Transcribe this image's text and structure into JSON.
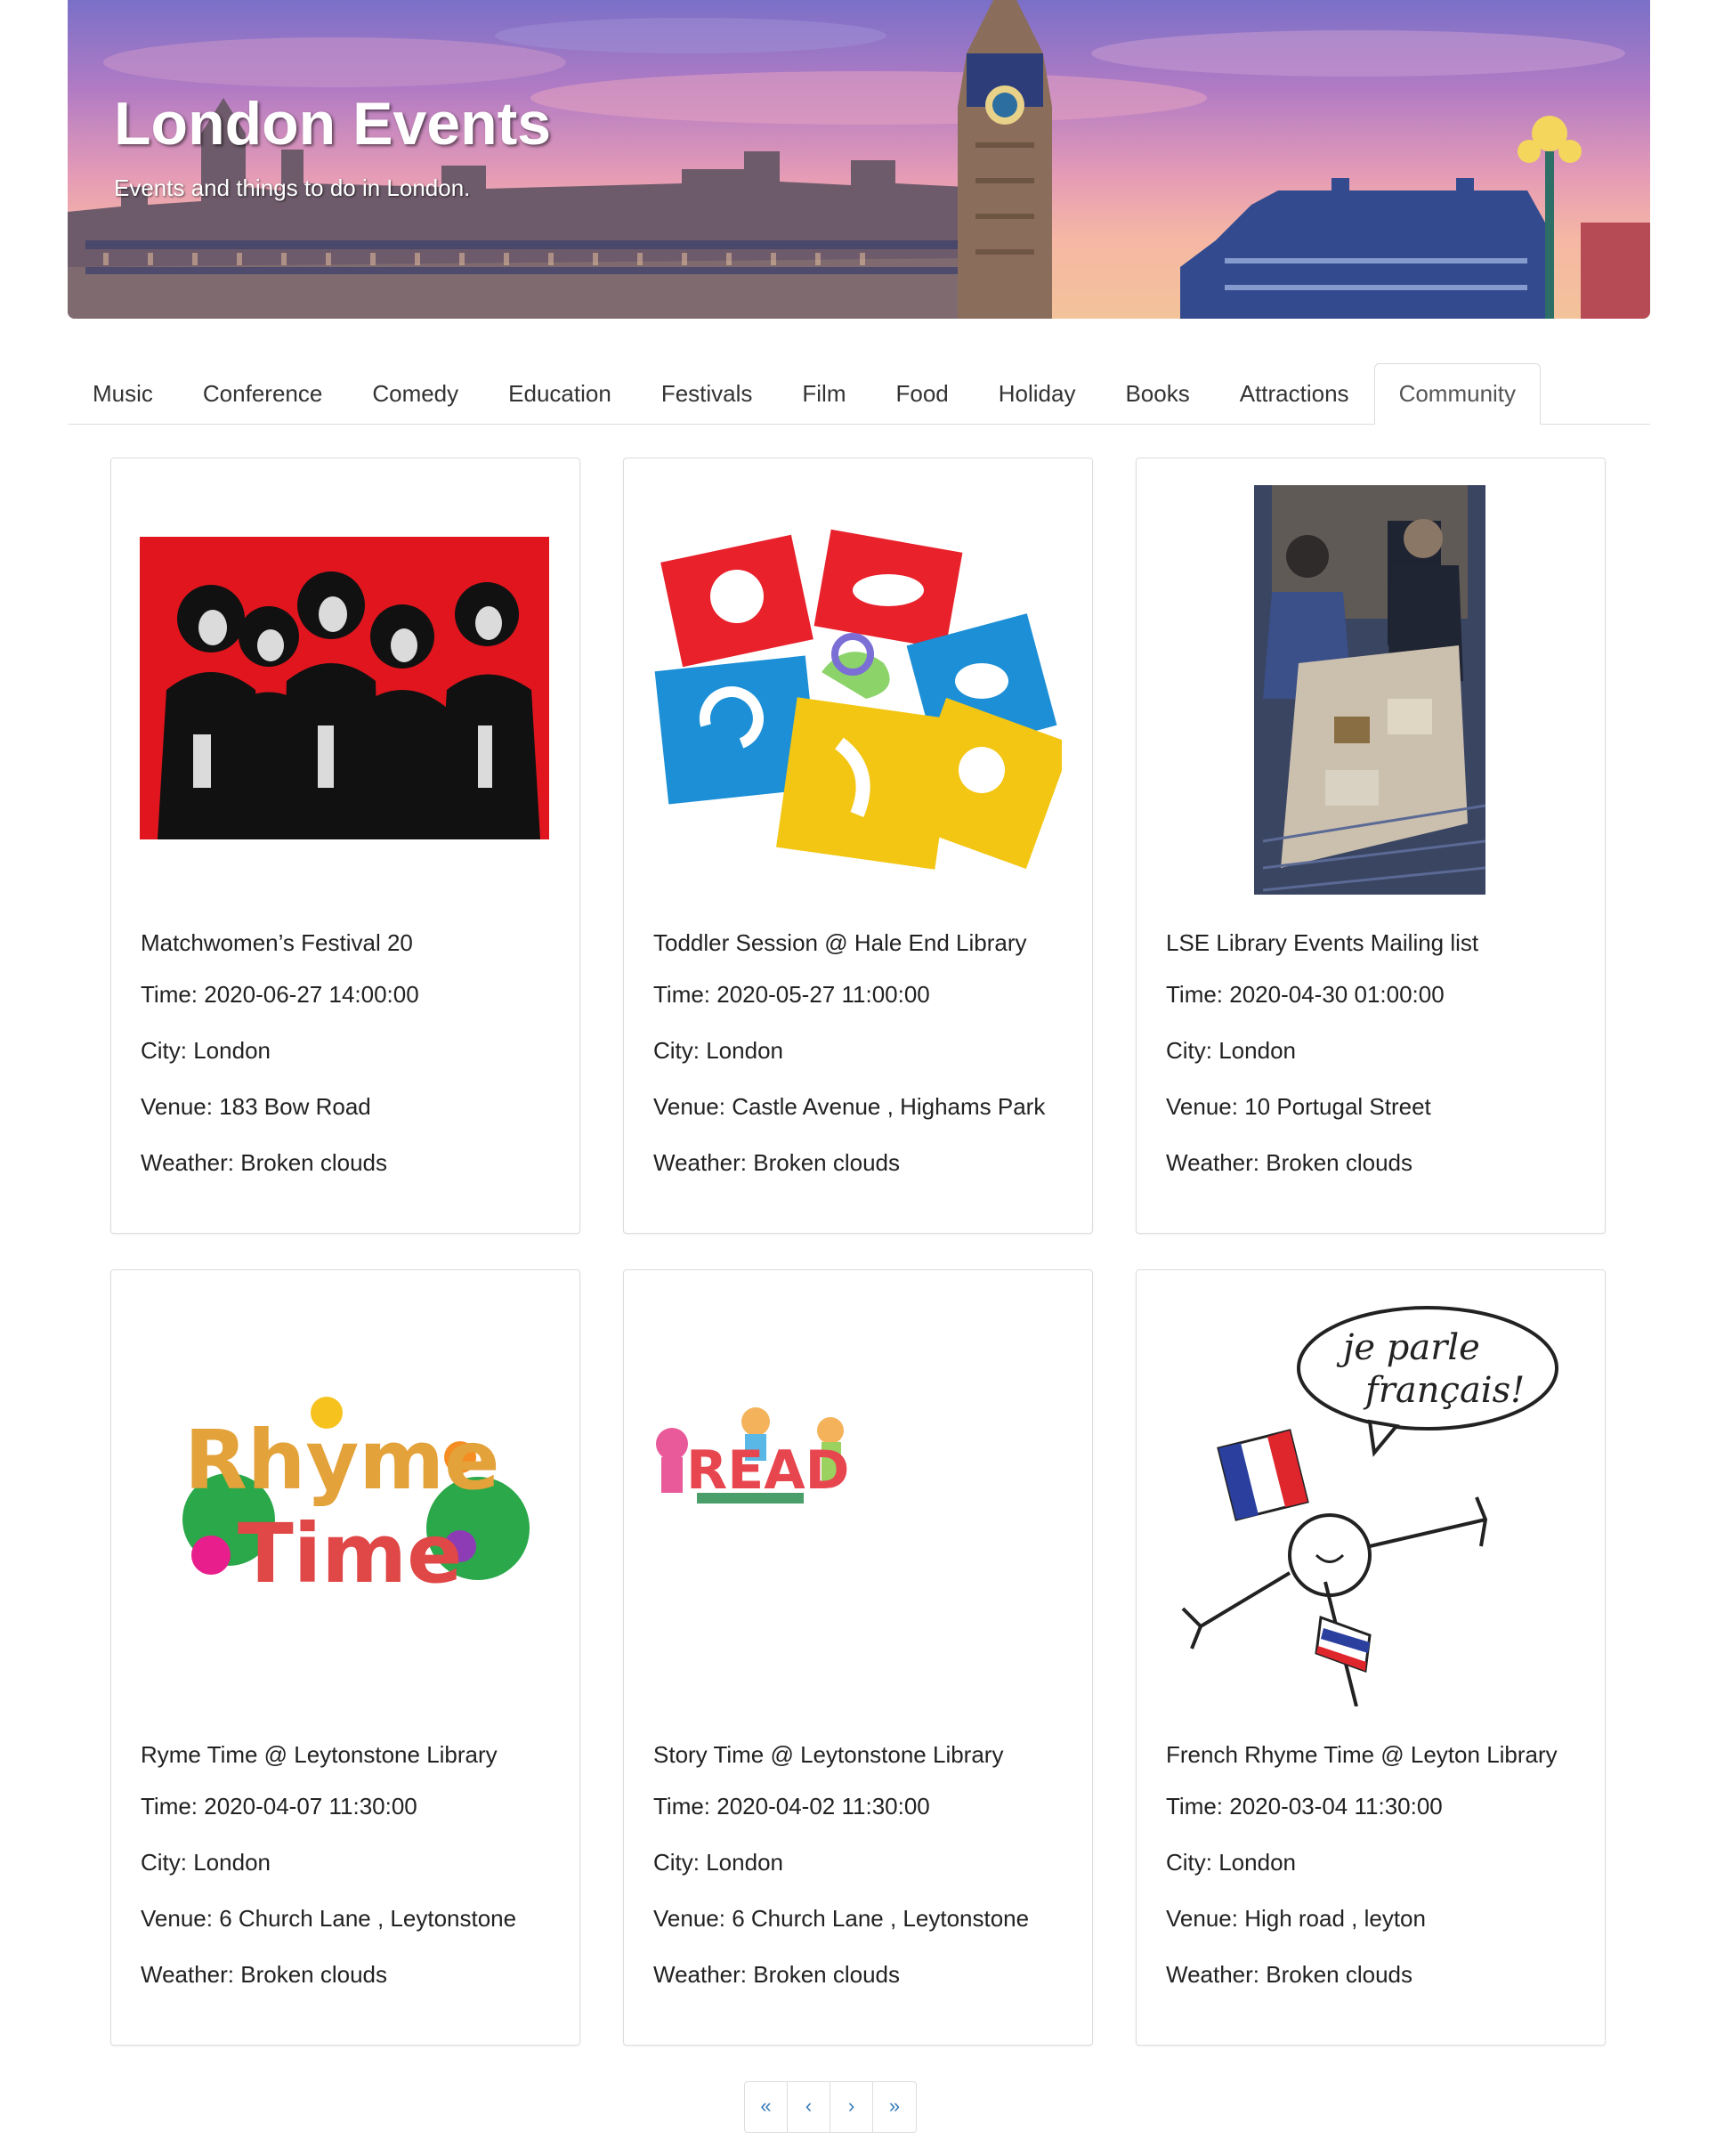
{
  "header": {
    "title": "London Events",
    "subtitle": "Events and things to do in London."
  },
  "tabs": [
    {
      "label": "Music"
    },
    {
      "label": "Conference"
    },
    {
      "label": "Comedy"
    },
    {
      "label": "Education"
    },
    {
      "label": "Festivals"
    },
    {
      "label": "Film"
    },
    {
      "label": "Food"
    },
    {
      "label": "Holiday"
    },
    {
      "label": "Books"
    },
    {
      "label": "Attractions"
    },
    {
      "label": "Community",
      "active": true
    }
  ],
  "events": [
    {
      "title": "Matchwomen’s Festival 20",
      "time": "Time: 2020-06-27 14:00:00",
      "city": "City: London",
      "venue": "Venue: 183 Bow Road",
      "weather": "Weather: Broken clouds",
      "image": "band-photo"
    },
    {
      "title": "Toddler Session @ Hale End Library",
      "time": "Time: 2020-05-27 11:00:00",
      "city": "City: London",
      "venue": "Venue: Castle Avenue , Highams Park",
      "weather": "Weather: Broken clouds",
      "image": "stencils"
    },
    {
      "title": "LSE Library Events Mailing list",
      "time": "Time: 2020-04-30 01:00:00",
      "city": "City: London",
      "venue": "Venue: 10 Portugal Street",
      "weather": "Weather: Broken clouds",
      "image": "library-display"
    },
    {
      "title": "Ryme Time @ Leytonstone Library",
      "time": "Time: 2020-04-07 11:30:00",
      "city": "City: London",
      "venue": "Venue: 6 Church Lane , Leytonstone",
      "weather": "Weather: Broken clouds",
      "image": "rhyme-time-logo",
      "image_text": [
        "Rhyme",
        "Time"
      ]
    },
    {
      "title": "Story Time @ Leytonstone Library",
      "time": "Time: 2020-04-02 11:30:00",
      "city": "City: London",
      "venue": "Venue: 6 Church Lane , Leytonstone",
      "weather": "Weather: Broken clouds",
      "image": "read-kids",
      "image_text": [
        "READ"
      ]
    },
    {
      "title": "French Rhyme Time @ Leyton Library",
      "time": "Time: 2020-03-04 11:30:00",
      "city": "City: London",
      "venue": "Venue: High road , leyton",
      "weather": "Weather: Broken clouds",
      "image": "french-cartoon",
      "image_text": [
        "je parle",
        "français!"
      ]
    }
  ],
  "pagination": {
    "first": "«",
    "prev": "‹",
    "next": "›",
    "last": "»"
  }
}
